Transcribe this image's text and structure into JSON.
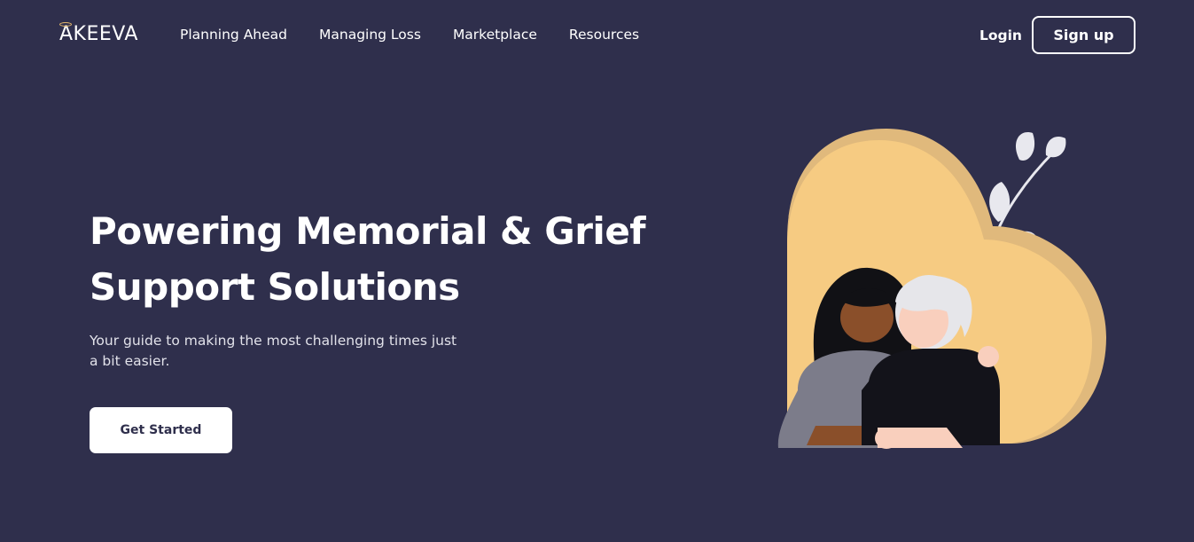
{
  "header": {
    "logo_text": "AKEEVA",
    "nav": [
      {
        "label": "Planning Ahead"
      },
      {
        "label": "Managing Loss"
      },
      {
        "label": "Marketplace"
      },
      {
        "label": "Resources"
      }
    ],
    "login_label": "Login",
    "signup_label": "Sign up"
  },
  "hero": {
    "title_line1": "Powering Memorial & Grief",
    "title_line2": "Support Solutions",
    "subtitle_line1": "Your guide to making the most challenging times just",
    "subtitle_line2": "a bit easier.",
    "cta_label": "Get Started"
  },
  "colors": {
    "background": "#2f2f4c",
    "heart": "#f6cb82",
    "heart_shadow": "#e0b97c",
    "accent_halo": "#e0b46a"
  },
  "illustration": {
    "icon": "heart-embrace-illustration"
  }
}
